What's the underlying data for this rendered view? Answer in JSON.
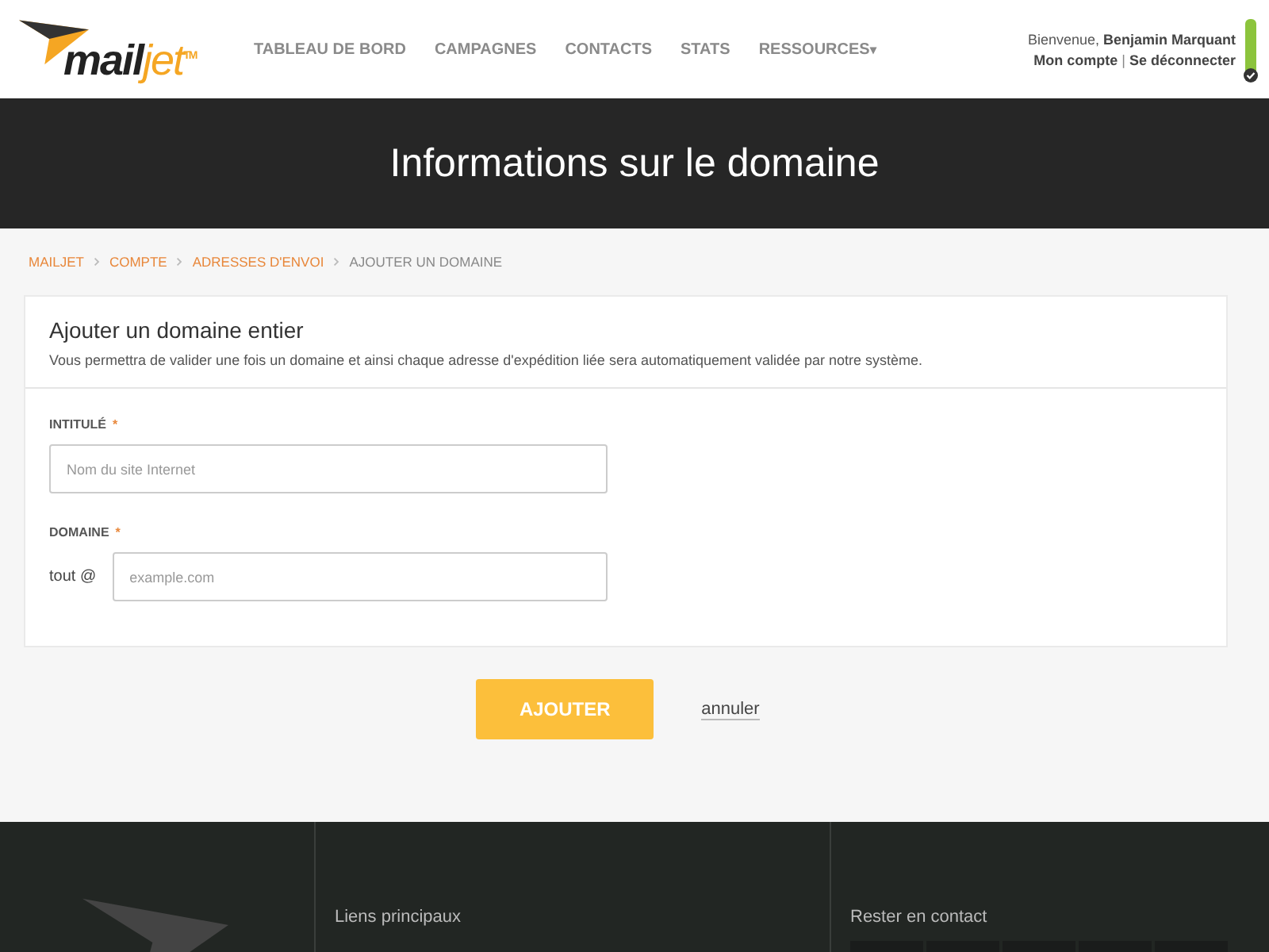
{
  "header": {
    "logo": {
      "name": "mail",
      "accent": "jet",
      "mark": "TM"
    },
    "nav": [
      {
        "label": "TABLEAU DE BORD"
      },
      {
        "label": "CAMPAGNES"
      },
      {
        "label": "CONTACTS"
      },
      {
        "label": "STATS"
      },
      {
        "label": "RESSOURCES",
        "caret": "▾"
      }
    ],
    "user": {
      "greeting": "Bienvenue,",
      "name": "Benjamin Marquant",
      "account_link": "Mon compte",
      "separator": "|",
      "logout_link": "Se déconnecter",
      "verified": true
    }
  },
  "hero": {
    "title": "Informations sur le domaine"
  },
  "breadcrumb": [
    {
      "label": "MAILJET",
      "current": false
    },
    {
      "label": "COMPTE",
      "current": false
    },
    {
      "label": "ADRESSES D'ENVOI",
      "current": false
    },
    {
      "label": "AJOUTER UN DOMAINE",
      "current": true
    }
  ],
  "card": {
    "title": "Ajouter un domaine entier",
    "description": "Vous permettra de valider une fois un domaine et ainsi chaque adresse d'expédition liée sera automatiquement validée par notre système.",
    "fields": [
      {
        "label": "INTITULÉ",
        "required_mark": "*",
        "placeholder": "Nom du site Internet"
      },
      {
        "label": "DOMAINE",
        "required_mark": "*",
        "prefix": "tout @",
        "placeholder": "example.com"
      }
    ]
  },
  "actions": {
    "submit": "AJOUTER",
    "cancel": "annuler"
  },
  "footer": {
    "columns": [
      {
        "title": "Liens principaux"
      },
      {
        "title": "Rester en contact",
        "social": true
      }
    ]
  }
}
